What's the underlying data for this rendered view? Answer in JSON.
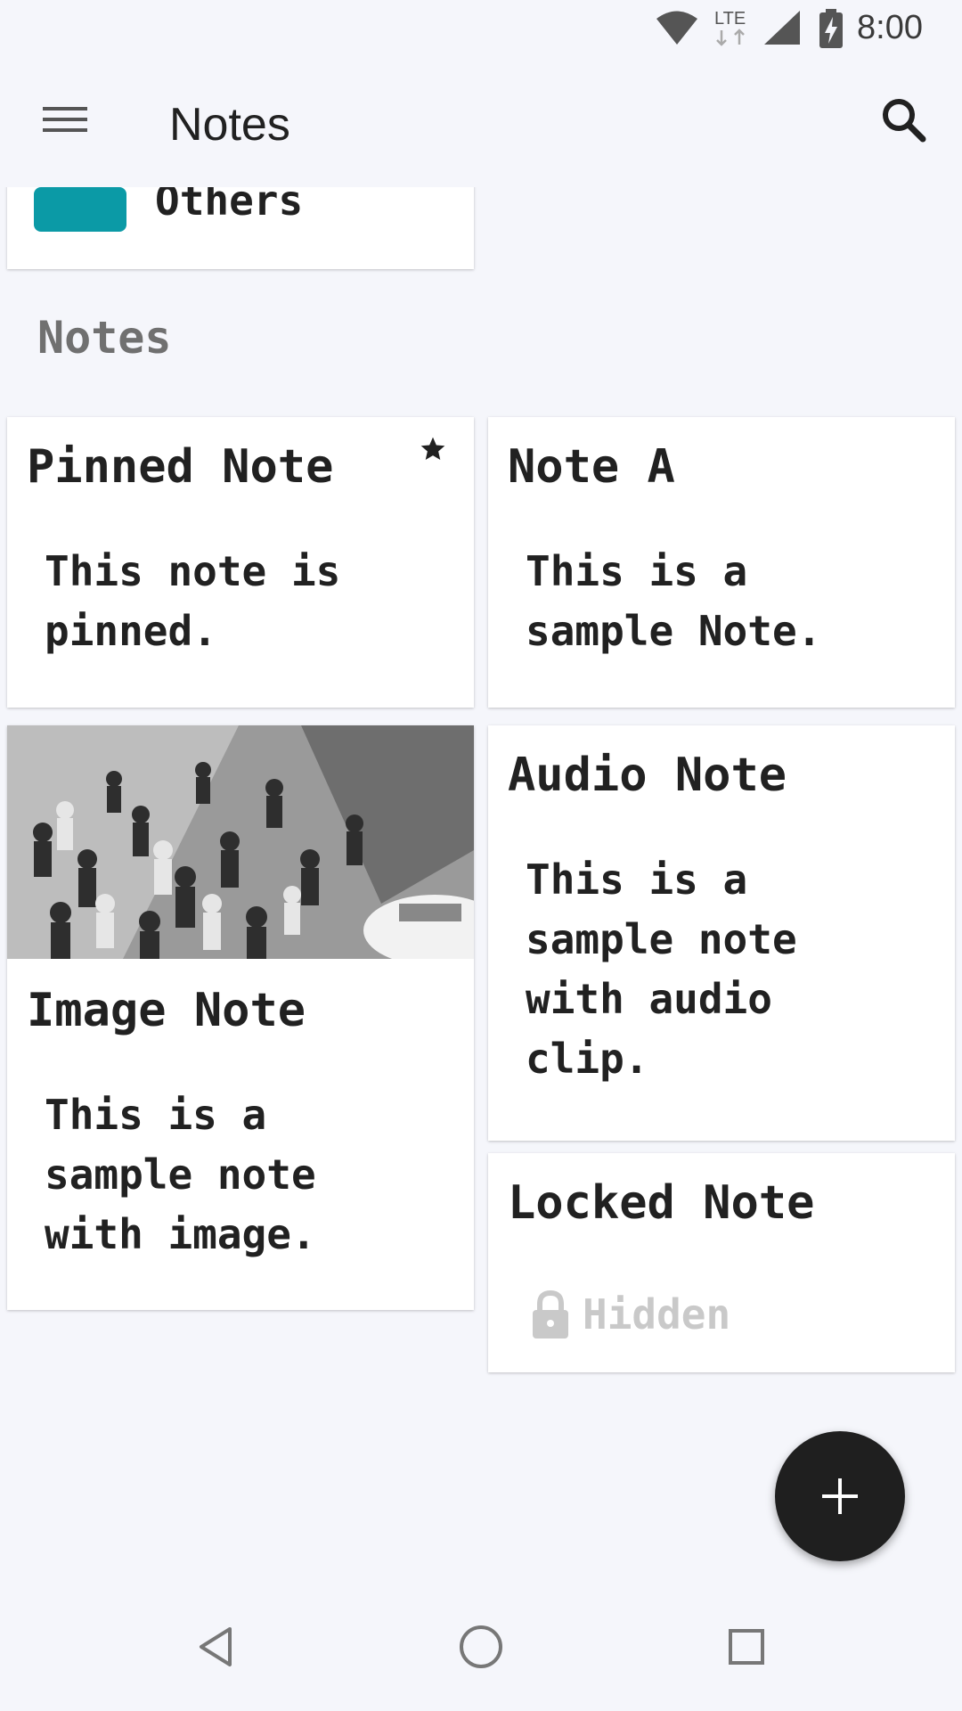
{
  "status_bar": {
    "time": "8:00",
    "network_label": "LTE",
    "icons": [
      "wifi-icon",
      "lte-icon",
      "signal-icon",
      "battery-charging-icon"
    ]
  },
  "app_bar": {
    "title": "Notes",
    "menu_icon": "hamburger-menu-icon",
    "search_icon": "search-icon"
  },
  "folder": {
    "label": "Others",
    "color": "#0b9aa6"
  },
  "section": {
    "title": "Notes"
  },
  "notes": [
    {
      "title": "Pinned Note",
      "body": "This note is\npinned.",
      "pinned": true
    },
    {
      "title": "Note A",
      "body": "This is a\nsample Note."
    },
    {
      "title": "Image Note",
      "body": "This is a\nsample note\nwith image.",
      "has_image": true
    },
    {
      "title": "Audio Note",
      "body": "This is a\nsample note\nwith audio\nclip."
    },
    {
      "title": "Locked Note",
      "locked_label": "Hidden",
      "locked": true
    }
  ],
  "fab": {
    "icon": "plus-icon"
  },
  "nav_bar": {
    "icons": [
      "back-icon",
      "home-icon",
      "recents-icon"
    ]
  }
}
